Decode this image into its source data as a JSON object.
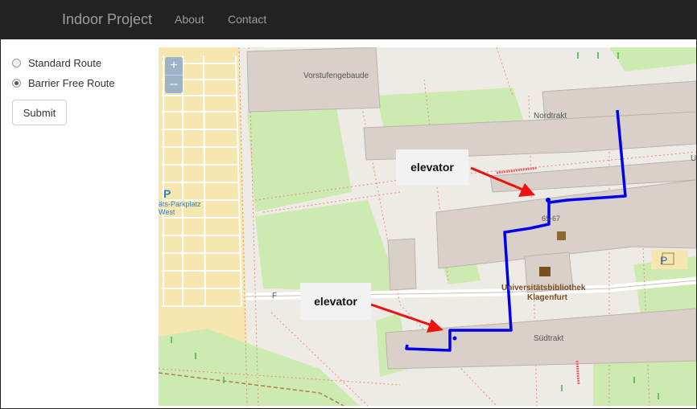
{
  "app": {
    "brand": "Indoor Project",
    "nav": [
      "About",
      "Contact"
    ]
  },
  "form": {
    "options": [
      {
        "label": "Standard Route",
        "selected": false
      },
      {
        "label": "Barrier Free Route",
        "selected": true
      }
    ],
    "submit_label": "Submit"
  },
  "map": {
    "zoom_in": "+",
    "zoom_out": "–",
    "labels": {
      "vorstufengebaude": "Vorstufengebaude",
      "nordtrakt": "Nordtrakt",
      "suedtrakt": "Südtrakt",
      "ub1": "Universitätsbibliothek",
      "ub2": "Klagenfurt",
      "number": "65-67",
      "parking_p": "P",
      "parking_name": "äts-Parkplatz",
      "parking_west": "West",
      "parking_p2": "P",
      "u_letter": "U",
      "f_letter": "F"
    },
    "callouts": [
      "elevator",
      "elevator"
    ],
    "route_color": "#0000ee",
    "arrow_color": "#ee1111"
  }
}
